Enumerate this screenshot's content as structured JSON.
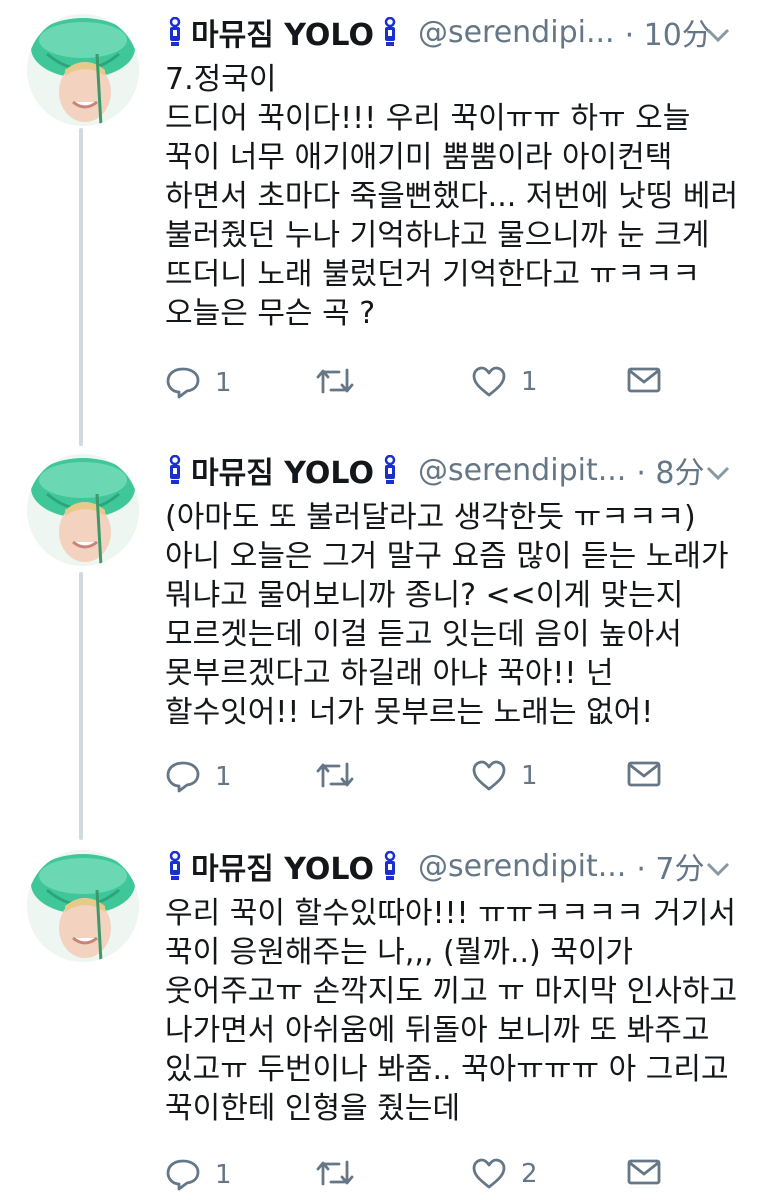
{
  "tweets": [
    {
      "display_name": "마뮤짐 YOLO",
      "handle": "@serendipi...",
      "time": "· 10分",
      "lines": [
        "7.정국이",
        "드디어 꾹이다!!! 우리 꾹이ㅠㅠ 하ㅠ 오늘",
        "꾹이 너무 애기애기미 뿜뿜이라 아이컨택",
        "하면서 초마다 죽을뻔했다... 저번에 낫띵 베러",
        "불러줬던 누나 기억하냐고 물으니까 눈 크게",
        "뜨더니 노래 불렀던거 기억한다고 ㅠㅋㅋㅋ",
        "오늘은 무슨 곡 ?"
      ],
      "reply_count": "1",
      "retweet_count": "",
      "like_count": "1"
    },
    {
      "display_name": "마뮤짐 YOLO",
      "handle": "@serendipit...",
      "time": "· 8分",
      "lines": [
        "(아마도 또 불러달라고 생각한듯 ㅠㅋㅋㅋ)",
        "아니 오늘은 그거 말구 요즘 많이 듣는 노래가",
        "뭐냐고 물어보니까 종니? <<이게 맞는지",
        "모르겟는데 이걸 듣고 잇는데 음이 높아서",
        "못부르겠다고 하길래 아냐 꾹아!! 넌",
        "할수잇어!! 너가 못부르는 노래는 없어!"
      ],
      "reply_count": "1",
      "retweet_count": "",
      "like_count": "1"
    },
    {
      "display_name": "마뮤짐 YOLO",
      "handle": "@serendipit...",
      "time": "· 7分",
      "lines": [
        "우리 꾹이 할수있따아!!! ㅠㅠㅋㅋㅋㅋ 거기서",
        "꾹이 응원해주는 나,,, (뭘까..) 꾹이가",
        "웃어주고ㅠ 손깍지도 끼고 ㅠ 마지막 인사하고",
        "나가면서 아쉬움에 뒤돌아 보니까 또 봐주고",
        "있고ㅠ 두번이나 봐줌.. 꾹아ㅠㅠㅠ 아 그리고",
        "꾹이한테 인형을 줬는데"
      ],
      "reply_count": "1",
      "retweet_count": "",
      "like_count": "2"
    }
  ],
  "icons": {
    "name_emoji": "bottle-pin-icon",
    "reply": "reply-icon",
    "retweet": "retweet-icon",
    "like": "heart-icon",
    "dm": "mail-icon",
    "more": "chevron-down-icon"
  },
  "colors": {
    "text": "#14171a",
    "secondary": "#657786",
    "pin_blue": "#1a2fd0",
    "thread_line": "#cfd9de"
  }
}
